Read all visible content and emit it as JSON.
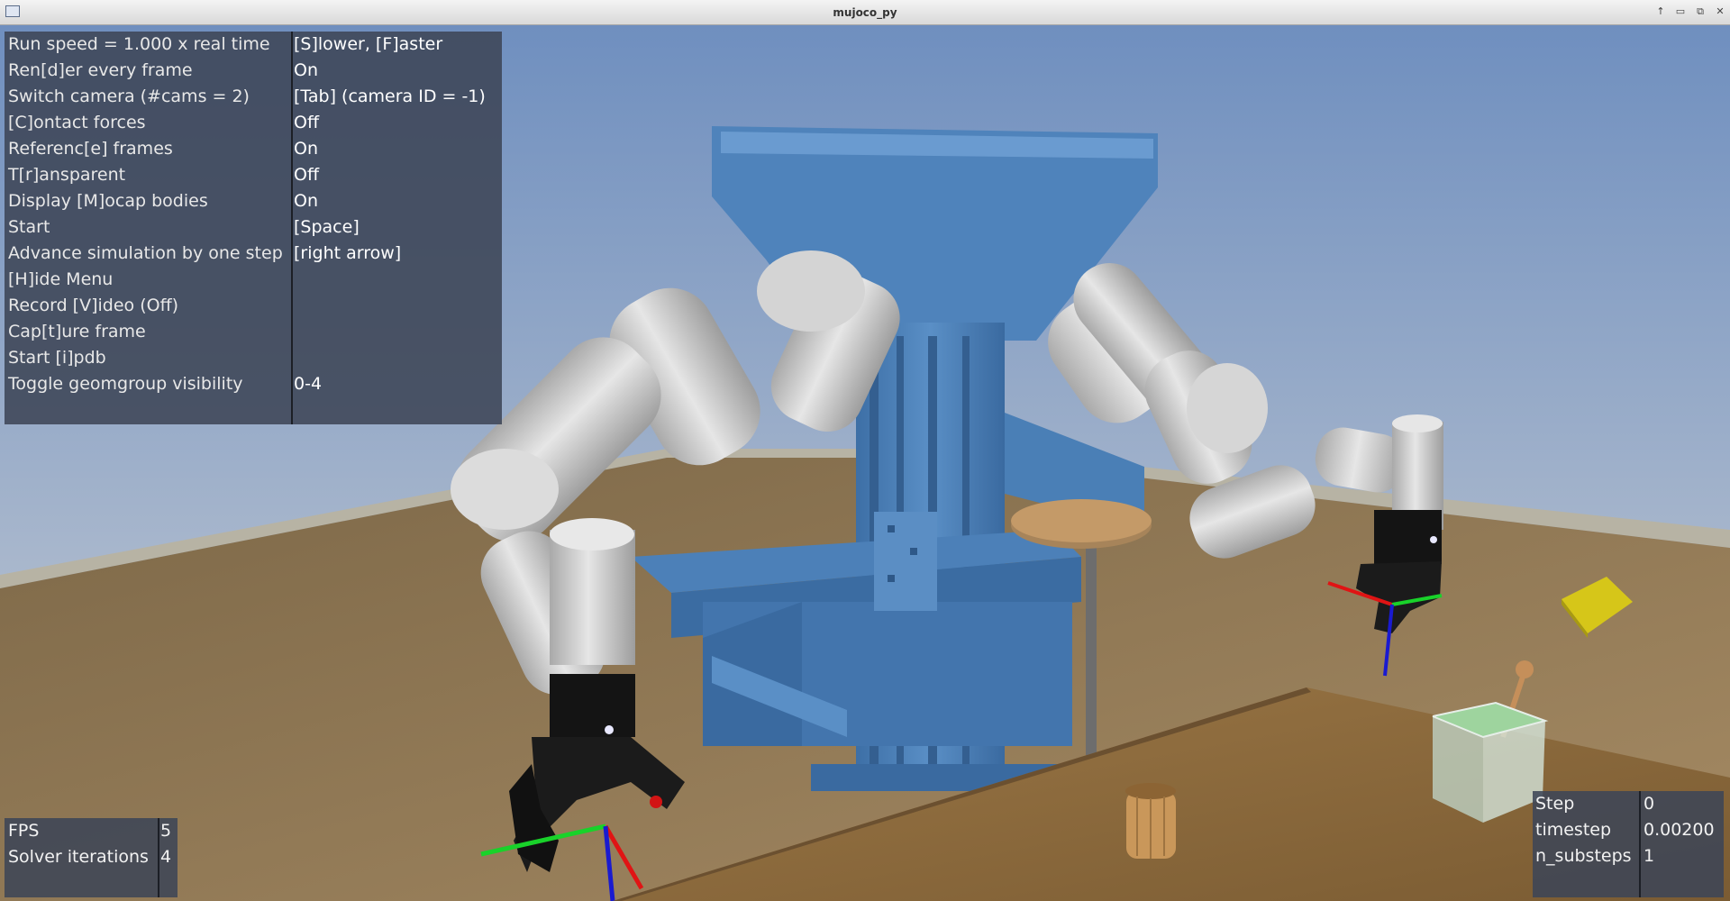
{
  "window": {
    "title": "mujoco_py",
    "controls": [
      "↑",
      "▭",
      "⧉",
      "✕"
    ]
  },
  "menu": {
    "rows": [
      {
        "label": "Run speed = 1.000 x real time",
        "value": "[S]lower, [F]aster"
      },
      {
        "label": "Ren[d]er every frame",
        "value": "On"
      },
      {
        "label": "Switch camera (#cams = 2)",
        "value": "[Tab] (camera ID = -1)"
      },
      {
        "label": "[C]ontact forces",
        "value": "Off"
      },
      {
        "label": "Referenc[e] frames",
        "value": "On"
      },
      {
        "label": "T[r]ansparent",
        "value": "Off"
      },
      {
        "label": "Display [M]ocap bodies",
        "value": "On"
      },
      {
        "label": "Start",
        "value": "[Space]"
      },
      {
        "label": "Advance simulation by one step",
        "value": "[right arrow]"
      },
      {
        "label": "[H]ide Menu",
        "value": ""
      },
      {
        "label": "Record [V]ideo (Off)",
        "value": ""
      },
      {
        "label": "Cap[t]ure frame",
        "value": ""
      },
      {
        "label": "Start [i]pdb",
        "value": ""
      },
      {
        "label": "Toggle geomgroup visibility",
        "value": "0-4"
      }
    ]
  },
  "fps_panel": {
    "rows": [
      {
        "label": "FPS",
        "value": "5"
      },
      {
        "label": "Solver iterations",
        "value": "4"
      }
    ]
  },
  "step_panel": {
    "rows": [
      {
        "label": "Step",
        "value": "0"
      },
      {
        "label": "timestep",
        "value": "0.00200"
      },
      {
        "label": "n_substeps",
        "value": "1"
      }
    ]
  },
  "scene": {
    "colors": {
      "sky_top": "#6f8fbf",
      "sky_bottom": "#c3ccd8",
      "floor": "#9a7c55",
      "table": "#8a6a3e",
      "frame_blue": "#4a7fb6",
      "robot_arm": "#c9c9c9",
      "gripper": "#1b1b1b",
      "cube": "#d6c619",
      "bin": "#b9d9bd",
      "cup": "#c89a5e"
    }
  }
}
